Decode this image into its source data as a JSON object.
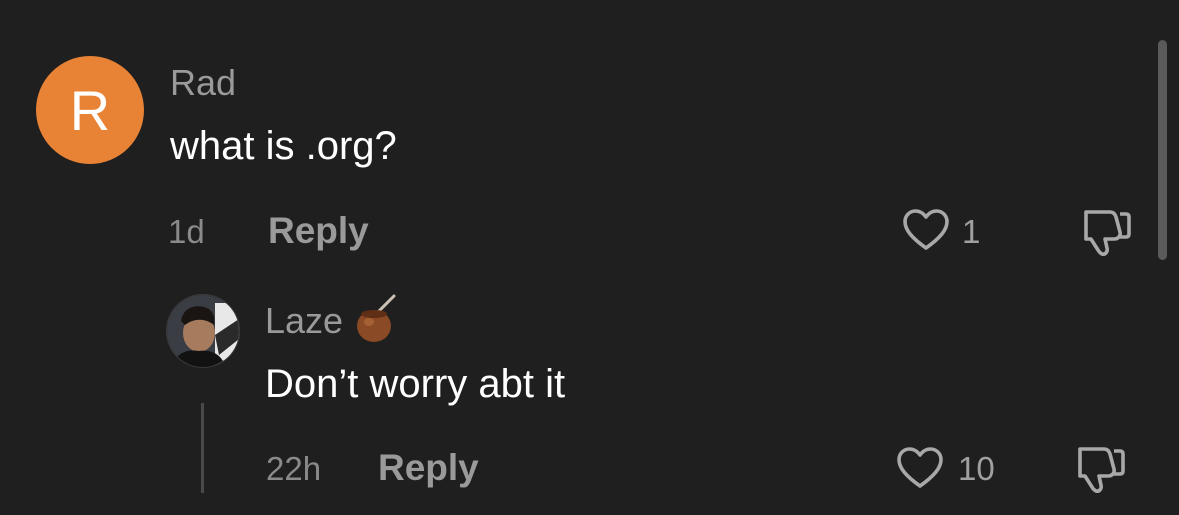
{
  "colors": {
    "background": "#1f1f1f",
    "avatar_orange": "#e88235",
    "muted_text": "#9a9a9a",
    "primary_text": "#ffffff"
  },
  "comments": [
    {
      "avatar_letter": "R",
      "username": "Rad",
      "text": "what is .org?",
      "time": "1d",
      "reply_label": "Reply",
      "like_count": "1",
      "icons": [
        "heart-icon",
        "dislike-icon"
      ]
    },
    {
      "avatar": "user-photo",
      "username": "Laze",
      "username_emoji": "mate-gourd-emoji",
      "text": "Don’t worry abt it",
      "time": "22h",
      "reply_label": "Reply",
      "like_count": "10",
      "icons": [
        "heart-icon",
        "dislike-icon"
      ]
    }
  ]
}
